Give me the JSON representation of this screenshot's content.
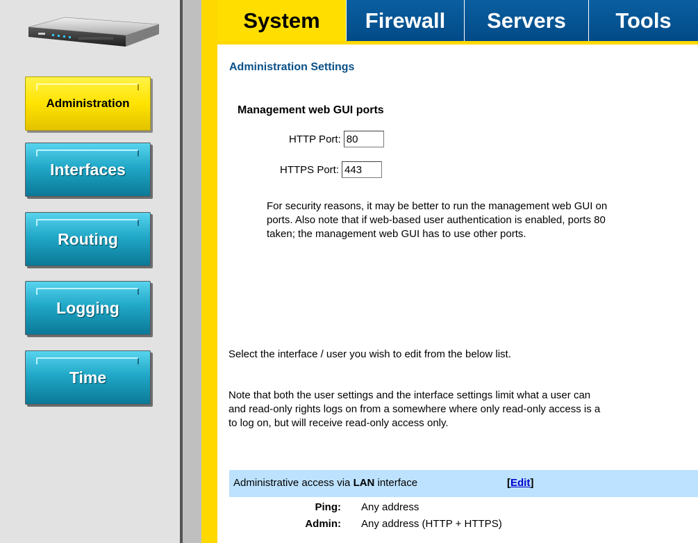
{
  "tabs": [
    {
      "label": "System",
      "active": true
    },
    {
      "label": "Firewall",
      "active": false
    },
    {
      "label": "Servers",
      "active": false
    },
    {
      "label": "Tools",
      "active": false
    }
  ],
  "sidebar": {
    "items": [
      {
        "label": "Administration",
        "active": true
      },
      {
        "label": "Interfaces",
        "active": false
      },
      {
        "label": "Routing",
        "active": false
      },
      {
        "label": "Logging",
        "active": false
      },
      {
        "label": "Time",
        "active": false
      }
    ]
  },
  "main": {
    "section_title": "Administration Settings",
    "ports": {
      "title": "Management web GUI ports",
      "http_label": "HTTP Port:",
      "http_value": "80",
      "https_label": "HTTPS Port:",
      "https_value": "443"
    },
    "security_note": [
      "For security reasons, it may be better to run the management web GUI on",
      "ports. Also note that if web-based user authentication is enabled, ports 80",
      "taken; the management web GUI has to use other ports."
    ],
    "select_text": "Select the interface / user you wish to edit from the below list.",
    "limit_note": [
      "Note that both the user settings and the interface settings limit what a user can",
      "and read-only rights logs on from a somewhere where only read-only access is a",
      "to log on, but will receive read-only access only."
    ],
    "access": {
      "prefix": "Administrative access via ",
      "interface": "LAN",
      "suffix": " interface",
      "edit_open": "[",
      "edit_label": "Edit",
      "edit_close": "]",
      "rows": [
        {
          "key": "Ping:",
          "value": "Any address"
        },
        {
          "key": "Admin:",
          "value": "Any address (HTTP + HTTPS)"
        }
      ]
    }
  },
  "colors": {
    "accent_yellow": "#ffde00",
    "tab_blue": "#0a5fa0",
    "nav_blue": "#21a8c8",
    "title_blue": "#0a4f86",
    "access_bar": "#bde2ff",
    "link": "#0000cc"
  },
  "icons": {
    "logo": "router-device-icon"
  }
}
